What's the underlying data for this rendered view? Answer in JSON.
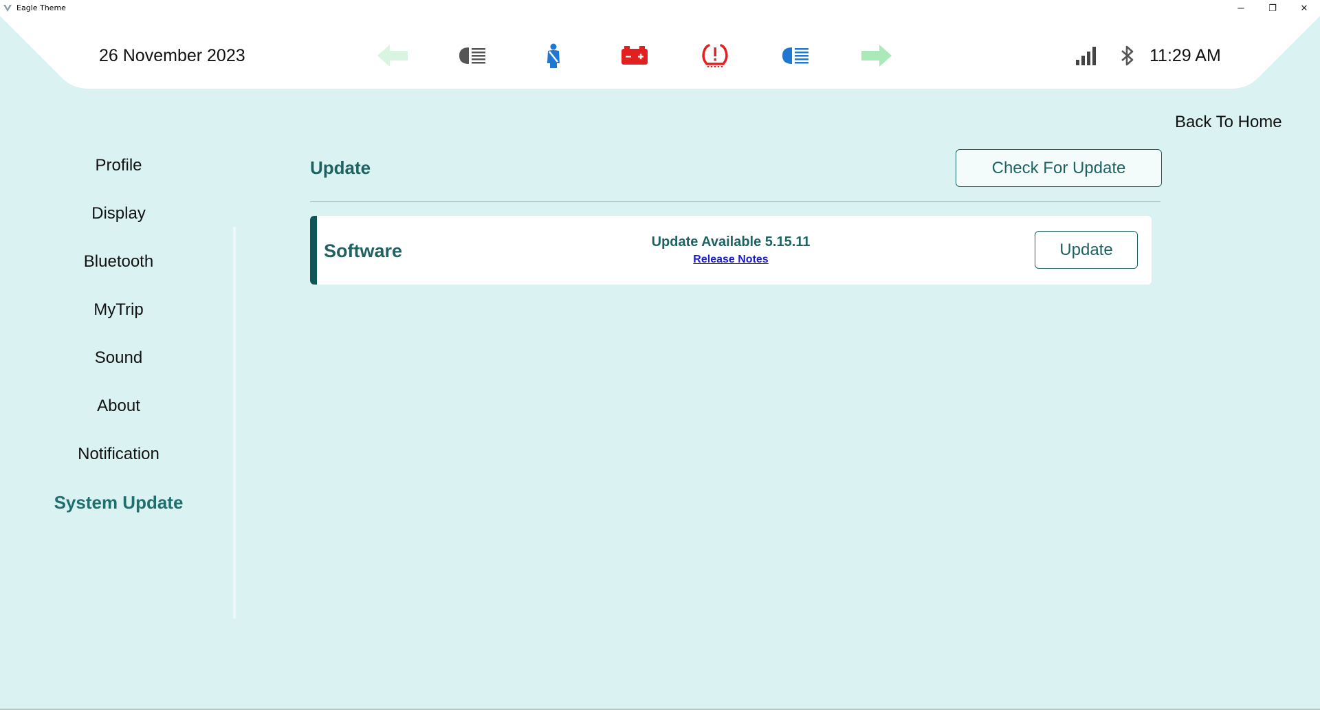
{
  "window": {
    "title": "Eagle Theme",
    "controls": {
      "minimize": "─",
      "restore": "❐",
      "close": "✕"
    }
  },
  "statusbar": {
    "date": "26 November 2023",
    "time": "11:29 AM",
    "tell_tales": [
      {
        "icon": "left-turn-arrow-icon",
        "color": "#d9f5e1"
      },
      {
        "icon": "headlight-low-beam-icon",
        "color": "#555555"
      },
      {
        "icon": "seatbelt-icon",
        "color": "#1e77d0"
      },
      {
        "icon": "battery-warning-icon",
        "color": "#e22020"
      },
      {
        "icon": "tire-pressure-warning-icon",
        "color": "#e22020"
      },
      {
        "icon": "headlight-high-beam-icon",
        "color": "#1e77d0"
      },
      {
        "icon": "right-turn-arrow-icon",
        "color": "#a9eab8"
      }
    ],
    "signal_icon": "signal-strength-icon",
    "bluetooth_icon": "bluetooth-icon"
  },
  "nav": {
    "back_home": "Back To Home"
  },
  "sidebar": {
    "items": [
      {
        "label": "Profile",
        "active": false
      },
      {
        "label": "Display",
        "active": false
      },
      {
        "label": "Bluetooth",
        "active": false
      },
      {
        "label": "MyTrip",
        "active": false
      },
      {
        "label": "Sound",
        "active": false
      },
      {
        "label": "About",
        "active": false
      },
      {
        "label": "Notification",
        "active": false
      },
      {
        "label": "System Update",
        "active": true
      }
    ]
  },
  "main": {
    "title": "Update",
    "check_button": "Check For Update",
    "software_card": {
      "label": "Software",
      "status": "Update Available 5.15.11",
      "release_notes": "Release Notes",
      "update_button": "Update"
    }
  },
  "colors": {
    "background": "#daf2f2",
    "accent": "#1f6262",
    "accent_dark": "#0f5757",
    "link": "#1a1ad6"
  }
}
